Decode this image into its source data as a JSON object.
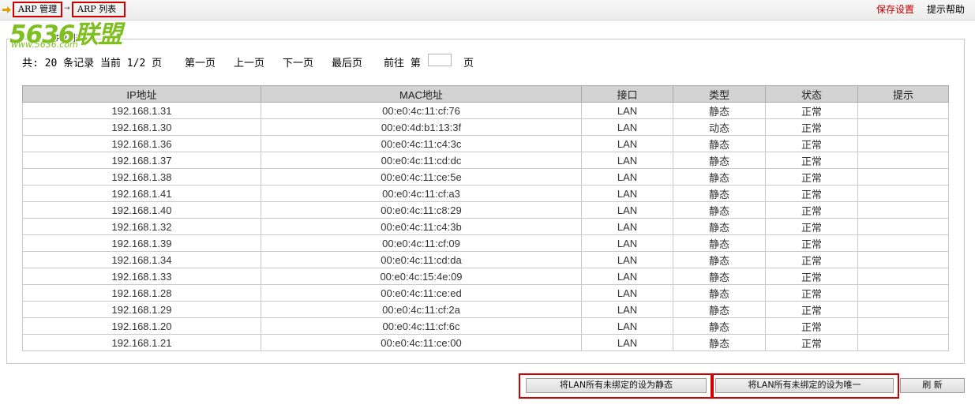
{
  "breadcrumb": {
    "item1": "ARP 管理",
    "separator": "→",
    "item2": "ARP 列表"
  },
  "top_links": {
    "save": "保存设置",
    "help": "提示帮助"
  },
  "watermark": {
    "logo": "5636联盟",
    "url": "www.5636.com"
  },
  "group_title": "ARP列表",
  "pager": {
    "total_text": "共: 20 条记录 当前 1/2 页",
    "first": "第一页",
    "prev": "上一页",
    "next": "下一页",
    "last": "最后页",
    "goto_prefix": "前往 第",
    "goto_suffix": "页",
    "page_input_value": ""
  },
  "table": {
    "columns": [
      "IP地址",
      "MAC地址",
      "接口",
      "类型",
      "状态",
      "提示"
    ],
    "rows": [
      [
        "192.168.1.31",
        "00:e0:4c:11:cf:76",
        "LAN",
        "静态",
        "正常",
        ""
      ],
      [
        "192.168.1.30",
        "00:e0:4d:b1:13:3f",
        "LAN",
        "动态",
        "正常",
        ""
      ],
      [
        "192.168.1.36",
        "00:e0:4c:11:c4:3c",
        "LAN",
        "静态",
        "正常",
        ""
      ],
      [
        "192.168.1.37",
        "00:e0:4c:11:cd:dc",
        "LAN",
        "静态",
        "正常",
        ""
      ],
      [
        "192.168.1.38",
        "00:e0:4c:11:ce:5e",
        "LAN",
        "静态",
        "正常",
        ""
      ],
      [
        "192.168.1.41",
        "00:e0:4c:11:cf:a3",
        "LAN",
        "静态",
        "正常",
        ""
      ],
      [
        "192.168.1.40",
        "00:e0:4c:11:c8:29",
        "LAN",
        "静态",
        "正常",
        ""
      ],
      [
        "192.168.1.32",
        "00:e0:4c:11:c4:3b",
        "LAN",
        "静态",
        "正常",
        ""
      ],
      [
        "192.168.1.39",
        "00:e0:4c:11:cf:09",
        "LAN",
        "静态",
        "正常",
        ""
      ],
      [
        "192.168.1.34",
        "00:e0:4c:11:cd:da",
        "LAN",
        "静态",
        "正常",
        ""
      ],
      [
        "192.168.1.33",
        "00:e0:4c:15:4e:09",
        "LAN",
        "静态",
        "正常",
        ""
      ],
      [
        "192.168.1.28",
        "00:e0:4c:11:ce:ed",
        "LAN",
        "静态",
        "正常",
        ""
      ],
      [
        "192.168.1.29",
        "00:e0:4c:11:cf:2a",
        "LAN",
        "静态",
        "正常",
        ""
      ],
      [
        "192.168.1.20",
        "00:e0:4c:11:cf:6c",
        "LAN",
        "静态",
        "正常",
        ""
      ],
      [
        "192.168.1.21",
        "00:e0:4c:11:ce:00",
        "LAN",
        "静态",
        "正常",
        ""
      ]
    ]
  },
  "buttons": {
    "set_static": "将LAN所有未绑定的设为静态",
    "set_unique": "将LAN所有未绑定的设为唯一",
    "refresh": "刷 新"
  },
  "colors": {
    "highlight_frame": "#d00000",
    "header_bg": "#d3d3d3",
    "save_link": "#c00000",
    "watermark": "#7fbf1f"
  }
}
